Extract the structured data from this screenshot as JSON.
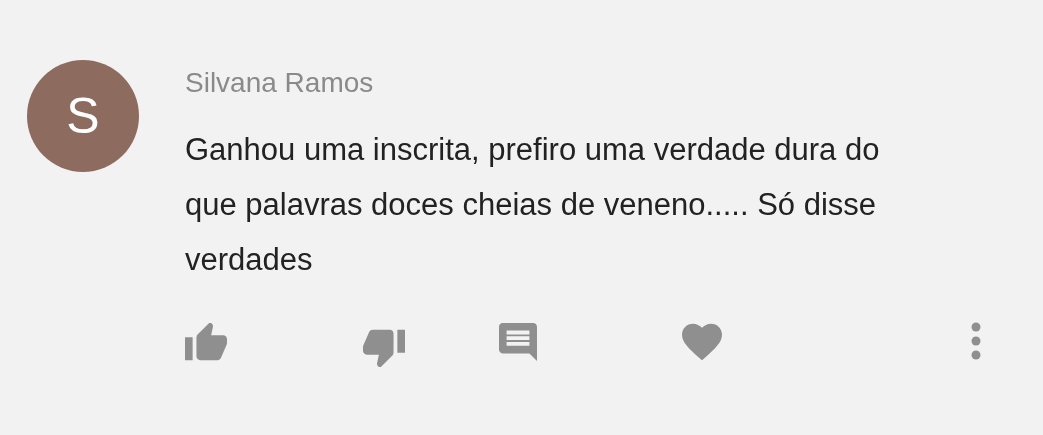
{
  "comment": {
    "avatar_letter": "S",
    "author": "Silvana Ramos",
    "text": "Ganhou uma inscrita, prefiro uma verdade dura do que palavras doces cheias de veneno..... Só disse verdades"
  }
}
